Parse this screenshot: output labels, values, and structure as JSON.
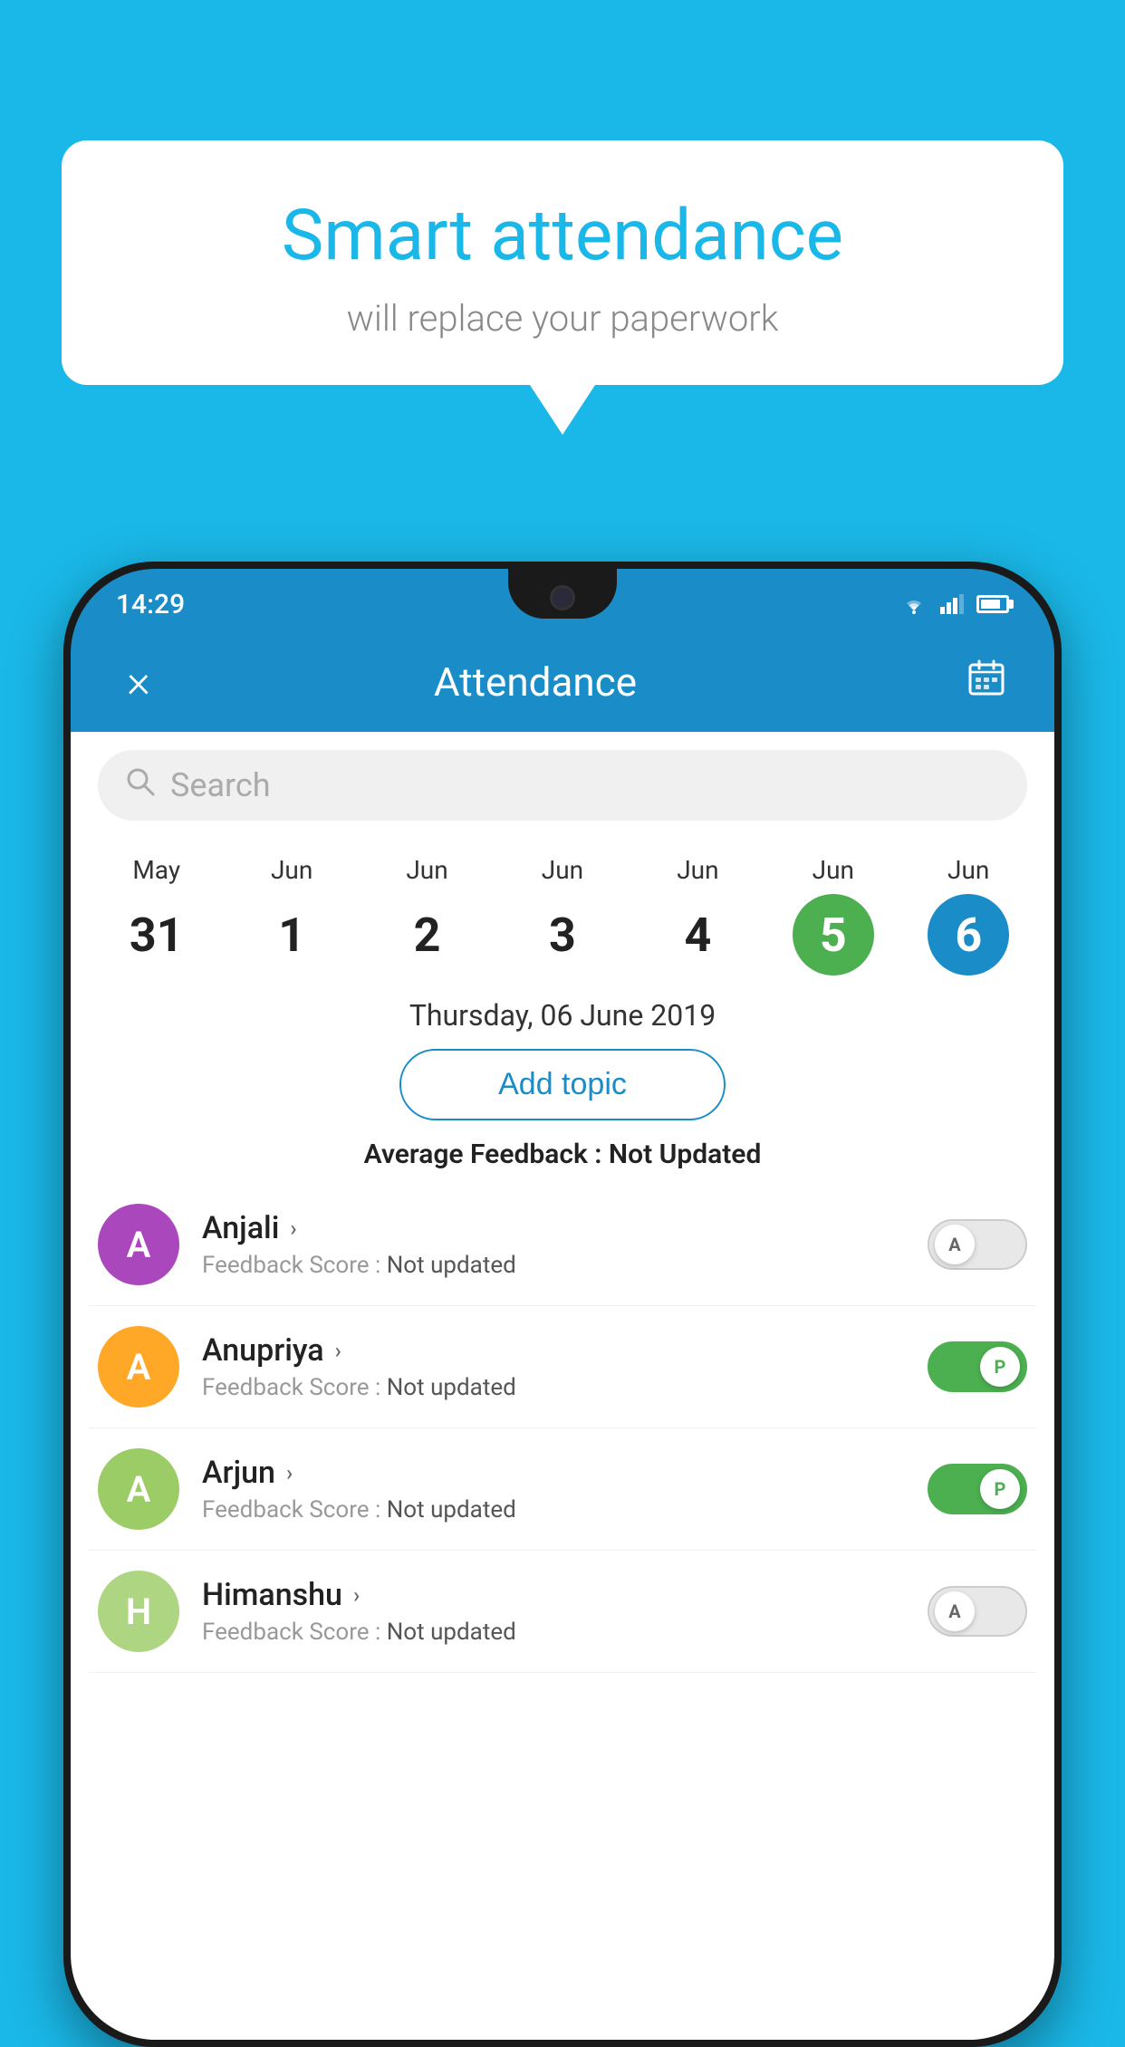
{
  "background_color": "#1ab8e8",
  "speech_bubble": {
    "title": "Smart attendance",
    "subtitle": "will replace your paperwork"
  },
  "status_bar": {
    "time": "14:29",
    "wifi_icon": "wifi-icon",
    "signal_icon": "signal-icon",
    "battery_icon": "battery-icon"
  },
  "app_header": {
    "title": "Attendance",
    "close_label": "×",
    "calendar_icon": "📅"
  },
  "search": {
    "placeholder": "Search"
  },
  "calendar": {
    "days": [
      {
        "month": "May",
        "number": "31",
        "state": "normal"
      },
      {
        "month": "Jun",
        "number": "1",
        "state": "normal"
      },
      {
        "month": "Jun",
        "number": "2",
        "state": "normal"
      },
      {
        "month": "Jun",
        "number": "3",
        "state": "normal"
      },
      {
        "month": "Jun",
        "number": "4",
        "state": "normal"
      },
      {
        "month": "Jun",
        "number": "5",
        "state": "today"
      },
      {
        "month": "Jun",
        "number": "6",
        "state": "selected"
      }
    ]
  },
  "selected_date": "Thursday, 06 June 2019",
  "add_topic_label": "Add topic",
  "avg_feedback_label": "Average Feedback :",
  "avg_feedback_value": "Not Updated",
  "students": [
    {
      "name": "Anjali",
      "avatar_letter": "A",
      "avatar_color": "#ab47bc",
      "score_label": "Feedback Score :",
      "score_value": "Not updated",
      "toggle_state": "off",
      "toggle_label": "A"
    },
    {
      "name": "Anupriya",
      "avatar_letter": "A",
      "avatar_color": "#ffa726",
      "score_label": "Feedback Score :",
      "score_value": "Not updated",
      "toggle_state": "on",
      "toggle_label": "P"
    },
    {
      "name": "Arjun",
      "avatar_letter": "A",
      "avatar_color": "#9ccc65",
      "score_label": "Feedback Score :",
      "score_value": "Not updated",
      "toggle_state": "on",
      "toggle_label": "P"
    },
    {
      "name": "Himanshu",
      "avatar_letter": "H",
      "avatar_color": "#aed581",
      "score_label": "Feedback Score :",
      "score_value": "Not updated",
      "toggle_state": "off",
      "toggle_label": "A"
    }
  ]
}
